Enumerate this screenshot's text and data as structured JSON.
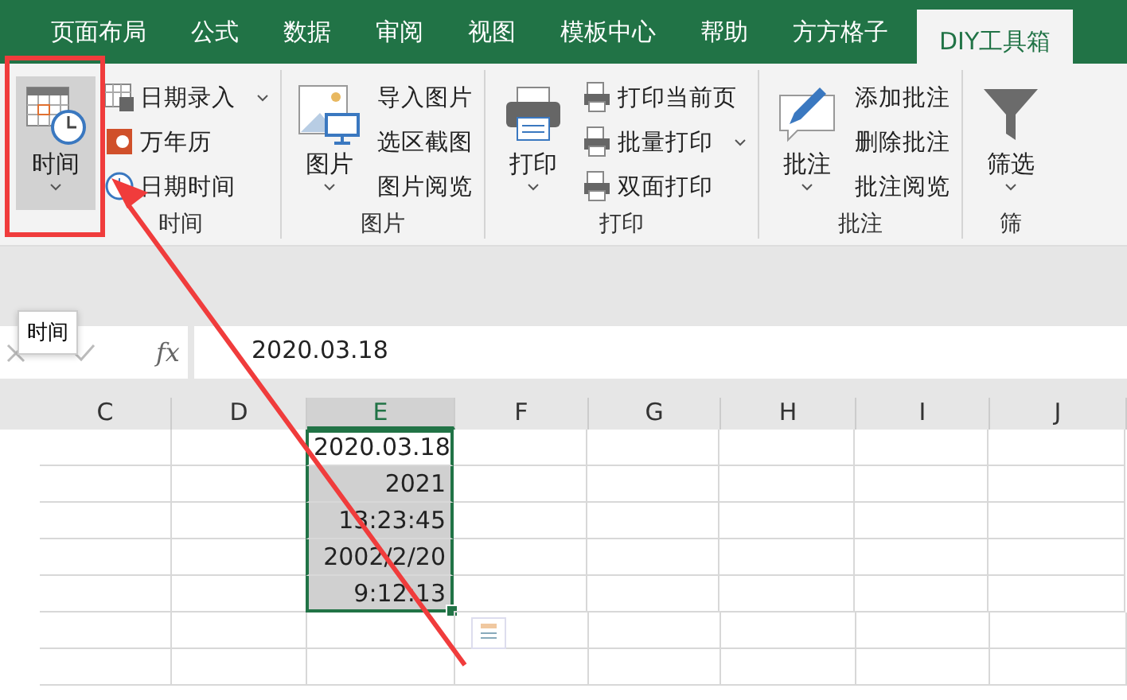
{
  "tabs": [
    {
      "label": "页面布局",
      "selected": false
    },
    {
      "label": "公式",
      "selected": false
    },
    {
      "label": "数据",
      "selected": false
    },
    {
      "label": "审阅",
      "selected": false
    },
    {
      "label": "视图",
      "selected": false
    },
    {
      "label": "模板中心",
      "selected": false
    },
    {
      "label": "帮助",
      "selected": false
    },
    {
      "label": "方方格子",
      "selected": false
    },
    {
      "label": "DIY工具箱",
      "selected": true
    }
  ],
  "ribbon_groups": [
    {
      "label": "时间",
      "big_button": {
        "label": "时间",
        "pressed": true,
        "dropdown": true
      },
      "items": [
        {
          "label": "日期录入",
          "dropdown": true
        },
        {
          "label": "万年历",
          "dropdown": false
        },
        {
          "label": "日期时间",
          "dropdown": false
        }
      ]
    },
    {
      "label": "图片",
      "big_button": {
        "label": "图片",
        "pressed": false,
        "dropdown": true
      },
      "items": [
        {
          "label": "导入图片",
          "dropdown": false
        },
        {
          "label": "选区截图",
          "dropdown": false
        },
        {
          "label": "图片阅览",
          "dropdown": false
        }
      ]
    },
    {
      "label": "打印",
      "big_button": {
        "label": "打印",
        "pressed": false,
        "dropdown": true
      },
      "items": [
        {
          "label": "打印当前页",
          "dropdown": false
        },
        {
          "label": "批量打印",
          "dropdown": true
        },
        {
          "label": "双面打印",
          "dropdown": false
        }
      ]
    },
    {
      "label": "批注",
      "big_button": {
        "label": "批注",
        "pressed": false,
        "dropdown": true
      },
      "items": [
        {
          "label": "添加批注",
          "dropdown": false
        },
        {
          "label": "删除批注",
          "dropdown": false
        },
        {
          "label": "批注阅览",
          "dropdown": false
        }
      ]
    },
    {
      "label": "筛",
      "big_button": {
        "label": "筛选",
        "pressed": false,
        "dropdown": true
      }
    }
  ],
  "tooltip": "时间",
  "formula_bar": {
    "function_label": "fx",
    "value": "2020.03.18"
  },
  "columns": [
    {
      "label": "C",
      "selected": false
    },
    {
      "label": "D",
      "selected": false
    },
    {
      "label": "E",
      "selected": true
    },
    {
      "label": "F",
      "selected": false
    },
    {
      "label": "G",
      "selected": false
    },
    {
      "label": "H",
      "selected": false
    },
    {
      "label": "I",
      "selected": false
    },
    {
      "label": "J",
      "selected": false
    }
  ],
  "cells": [
    {
      "value": "2020.03.18",
      "active": true
    },
    {
      "value": "2021",
      "active": false
    },
    {
      "value": "13:23:45",
      "active": false
    },
    {
      "value": "2002/2/20",
      "active": false
    },
    {
      "value": "9:12:13",
      "active": false
    }
  ]
}
